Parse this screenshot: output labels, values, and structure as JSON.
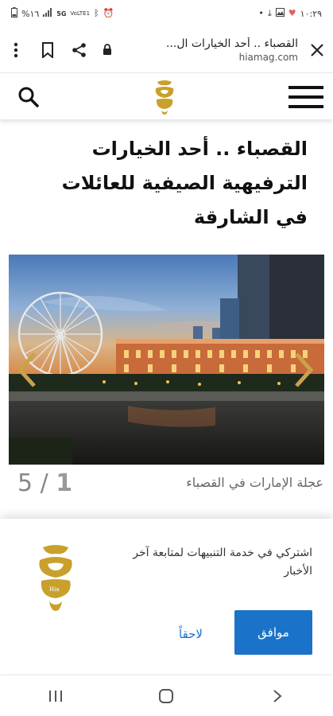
{
  "status_bar": {
    "time": "١٠:٢٩",
    "battery": "%١٦",
    "network": "5G",
    "volte": "VoLTE1"
  },
  "browser": {
    "page_title": "القصباء .. أحد الخيارات ال...",
    "domain": "hiamag.com",
    "icons": [
      "close-icon",
      "lock-icon",
      "share-icon",
      "bookmark-icon",
      "more-icon"
    ]
  },
  "site_header": {
    "logo_alt": "hia",
    "icons": [
      "menu-icon",
      "search-icon"
    ]
  },
  "article": {
    "headline": "القصباء .. أحد الخيارات الترفيهية الصيفية للعائلات في الشارقة"
  },
  "gallery": {
    "current": "1",
    "separator": "/",
    "total": "5",
    "caption": "عجلة الإمارات في القصباء"
  },
  "notification_prompt": {
    "text": "اشتركي في خدمة التنبيهات لمتابعة آخر الأخبار",
    "accept_label": "موافق",
    "later_label": "لاحقاً",
    "logo_small_text": "Hia",
    "accent_color": "#1a73c8",
    "logo_color": "#c9a02c"
  },
  "nav_bar": {
    "icons": [
      "recent-apps-icon",
      "home-icon",
      "back-icon"
    ]
  }
}
